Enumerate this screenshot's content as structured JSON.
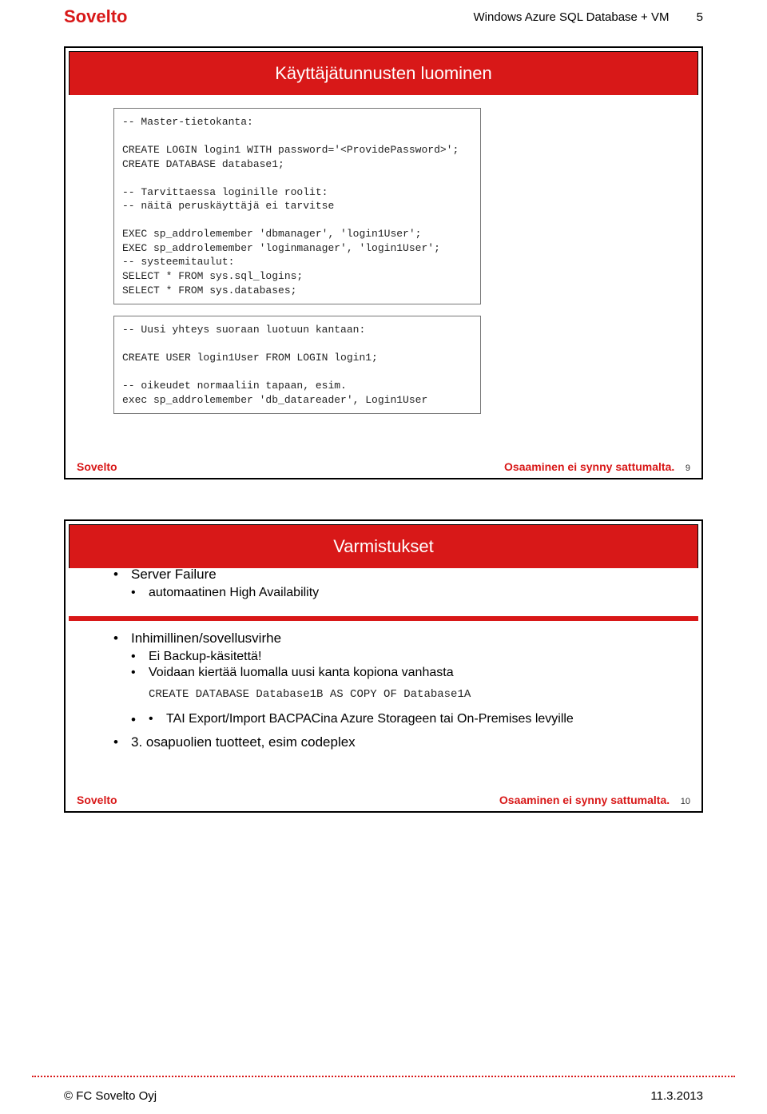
{
  "header": {
    "logo": "Sovelto",
    "title": "Windows Azure SQL Database + VM",
    "pagenum": "5"
  },
  "slide1": {
    "title": "Käyttäjätunnusten luominen",
    "code1": "-- Master-tietokanta:\n\nCREATE LOGIN login1 WITH password='<ProvidePassword>';\nCREATE DATABASE database1;\n\n-- Tarvittaessa loginille roolit:\n-- näitä peruskäyttäjä ei tarvitse\n\nEXEC sp_addrolemember 'dbmanager', 'login1User';\nEXEC sp_addrolemember 'loginmanager', 'login1User';\n-- systeemitaulut:\nSELECT * FROM sys.sql_logins;\nSELECT * FROM sys.databases;",
    "code2": "-- Uusi yhteys suoraan luotuun kantaan:\n\nCREATE USER login1User FROM LOGIN login1;\n\n-- oikeudet normaaliin tapaan, esim.\nexec sp_addrolemember 'db_datareader', Login1User",
    "footer_logo": "Sovelto",
    "tagline": "Osaaminen ei synny sattumalta.",
    "num": "9"
  },
  "slide2": {
    "title": "Varmistukset",
    "b1": "Server Failure",
    "b1a": "automaatinen High Availability",
    "b2": "Inhimillinen/sovellusvirhe",
    "b2a": "Ei Backup-käsitettä!",
    "b2b": "Voidaan kiertää luomalla uusi kanta kopiona vanhasta",
    "code": "CREATE DATABASE Database1B AS COPY OF Database1A",
    "b2c": "TAI Export/Import BACPACina Azure Storageen tai On-Premises levyille",
    "b3": "3. osapuolien tuotteet, esim codeplex",
    "footer_logo": "Sovelto",
    "tagline": "Osaaminen ei synny sattumalta.",
    "num": "10"
  },
  "footer": {
    "left": "© FC Sovelto Oyj",
    "right": "11.3.2013"
  }
}
